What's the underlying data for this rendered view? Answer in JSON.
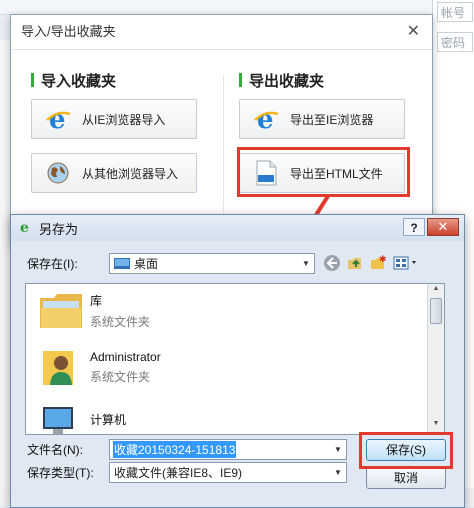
{
  "background": {
    "account_placeholder": "帐号",
    "password_placeholder": "密码"
  },
  "fav_dialog": {
    "title": "导入/导出收藏夹",
    "import_title": "导入收藏夹",
    "export_title": "导出收藏夹",
    "import_ie_label": "从IE浏览器导入",
    "import_other_label": "从其他浏览器导入",
    "export_ie_label": "导出至IE浏览器",
    "export_html_label": "导出至HTML文件",
    "html_badge": "html"
  },
  "save_dialog": {
    "title": "另存为",
    "help_label": "?",
    "save_in_label": "保存在(I):",
    "save_in_value": "桌面",
    "items": [
      {
        "name": "库",
        "type": "系统文件夹"
      },
      {
        "name": "Administrator",
        "type": "系统文件夹"
      },
      {
        "name": "计算机",
        "type": ""
      }
    ],
    "filename_label": "文件名(N):",
    "filename_value": "收藏20150324-151813",
    "filetype_label": "保存类型(T):",
    "filetype_value": "收藏文件(兼容IE8、IE9)",
    "save_button": "保存(S)",
    "cancel_button": "取消"
  },
  "colors": {
    "highlight": "#e23a2d",
    "accent_green": "#39a93a",
    "ie_blue": "#1e7fd8"
  }
}
